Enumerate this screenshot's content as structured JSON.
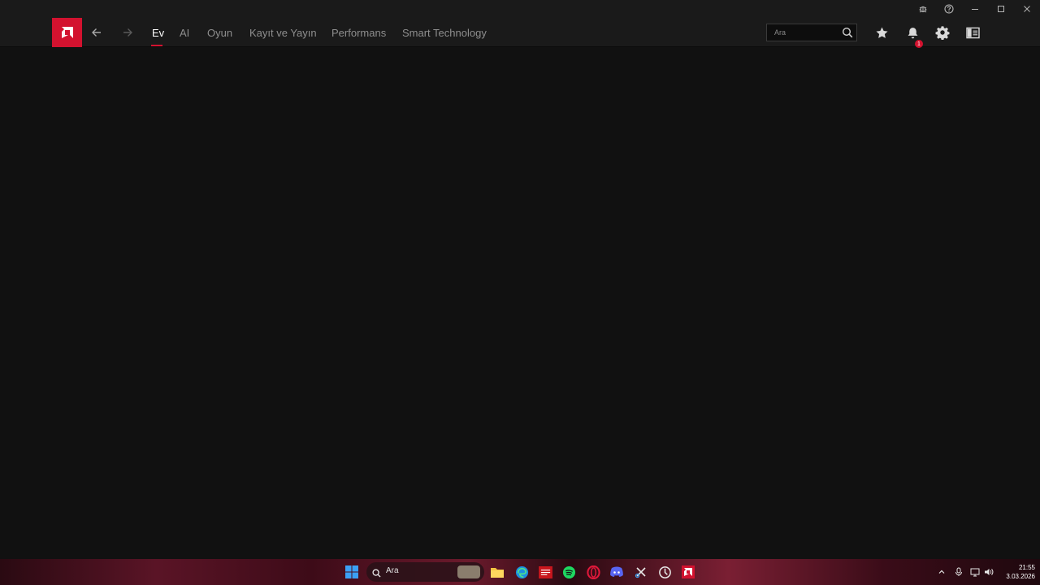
{
  "window": {
    "controls": [
      "bug-icon",
      "help-icon",
      "minimize-icon",
      "maximize-icon",
      "close-icon"
    ]
  },
  "header": {
    "tabs": [
      {
        "label": "Ev",
        "active": true
      },
      {
        "label": "AI",
        "active": false
      },
      {
        "label": "Oyun",
        "active": false
      },
      {
        "label": "Kayıt ve Yayın",
        "active": false
      },
      {
        "label": "Performans",
        "active": false
      },
      {
        "label": "Smart Technology",
        "active": false
      }
    ],
    "search": {
      "placeholder": "Ara"
    },
    "notification_count": "1",
    "accent_color": "#d3122f"
  },
  "taskbar": {
    "search_text": "Ara",
    "clock": {
      "time": "21:55",
      "date": "3.03.2026"
    }
  }
}
